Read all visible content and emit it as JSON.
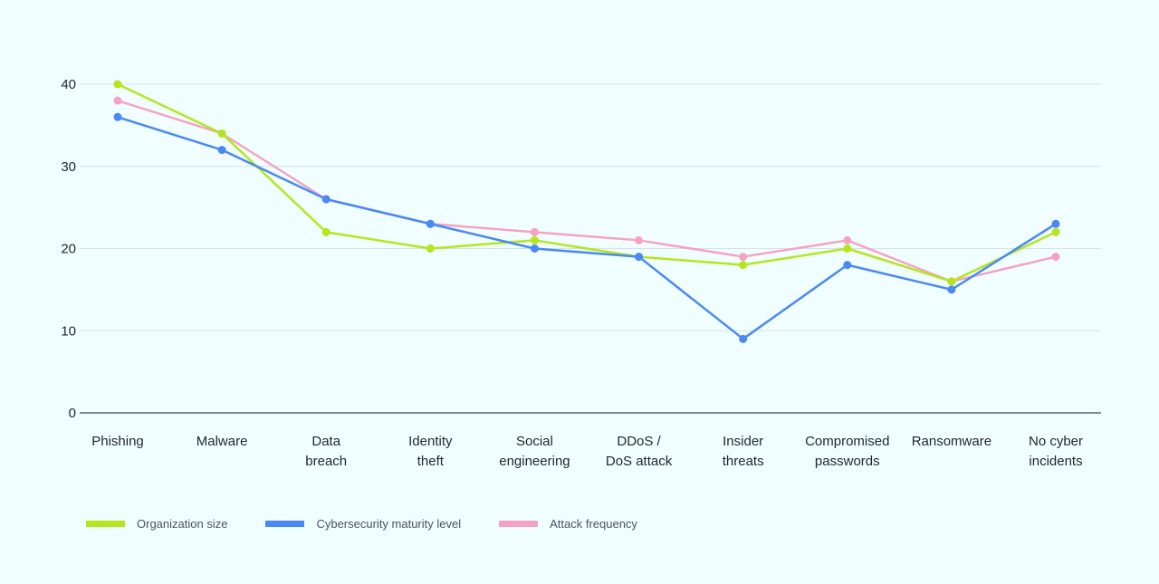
{
  "chart_data": {
    "type": "line",
    "title": "",
    "xlabel": "",
    "ylabel": "",
    "categories": [
      "Phishing",
      "Malware",
      "Data breach",
      "Identity theft",
      "Social engineering",
      "DDoS / DoS attack",
      "Insider threats",
      "Compromised passwords",
      "Ransomware",
      "No cyber incidents"
    ],
    "category_lines": [
      [
        "Phishing"
      ],
      [
        "Malware"
      ],
      [
        "Data",
        "breach"
      ],
      [
        "Identity",
        "theft"
      ],
      [
        "Social",
        "engineering"
      ],
      [
        "DDoS /",
        "DoS attack"
      ],
      [
        "Insider",
        "threats"
      ],
      [
        "Compromised",
        "passwords"
      ],
      [
        "Ransomware"
      ],
      [
        "No cyber",
        "incidents"
      ]
    ],
    "ylim": [
      0,
      40
    ],
    "yticks": [
      0,
      10,
      20,
      30,
      40
    ],
    "grid": true,
    "legend_position": "bottom-left",
    "series": [
      {
        "name": "Organization size",
        "color": "#b5e61d",
        "values": [
          40,
          34,
          22,
          20,
          21,
          19,
          18,
          20,
          16,
          22
        ]
      },
      {
        "name": "Cybersecurity maturity level",
        "color": "#4a88f5",
        "values": [
          36,
          32,
          26,
          23,
          20,
          19,
          9,
          18,
          15,
          23
        ]
      },
      {
        "name": "Attack frequency",
        "color": "#f4a3c4",
        "values": [
          38,
          34,
          26,
          23,
          22,
          21,
          19,
          21,
          16,
          19
        ]
      }
    ]
  }
}
